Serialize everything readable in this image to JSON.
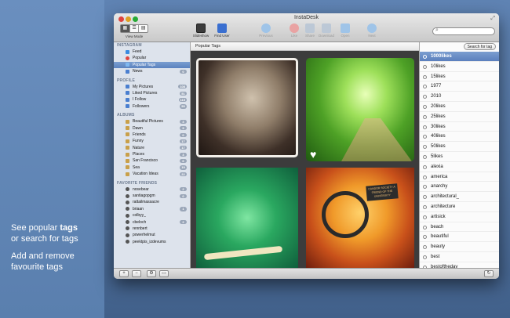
{
  "window": {
    "title": "InstaDesk"
  },
  "promo": {
    "line1_pre": "See popular ",
    "line1_bold": "tags",
    "line2": "or search for tags",
    "line3": "Add and remove favourite tags"
  },
  "toolbar": {
    "view_mode_label": "View Mode",
    "buttons": [
      {
        "label": "Slideshow",
        "icon": "slideshow-icon",
        "enabled": true
      },
      {
        "label": "Find User",
        "icon": "find-user-icon",
        "enabled": true
      },
      {
        "label": "Previous",
        "icon": "previous-arrow-icon",
        "enabled": false
      },
      {
        "label": "Like",
        "icon": "heart-icon",
        "enabled": false
      },
      {
        "label": "Share",
        "icon": "share-icon",
        "enabled": false
      },
      {
        "label": "Download",
        "icon": "download-icon",
        "enabled": false
      },
      {
        "label": "Open",
        "icon": "open-icon",
        "enabled": false
      },
      {
        "label": "Next",
        "icon": "next-arrow-icon",
        "enabled": false
      }
    ]
  },
  "sidebar": {
    "instagram": {
      "heading": "INSTAGRAM",
      "items": [
        {
          "label": "Feed",
          "badge": ""
        },
        {
          "label": "Popular",
          "badge": ""
        },
        {
          "label": "Popular Tags",
          "badge": ""
        },
        {
          "label": "News",
          "badge": "0"
        }
      ]
    },
    "profile": {
      "heading": "PROFILE",
      "items": [
        {
          "label": "My Pictures",
          "badge": "108"
        },
        {
          "label": "Liked Pictures",
          "badge": "51"
        },
        {
          "label": "I Follow",
          "badge": "115"
        },
        {
          "label": "Followers",
          "badge": "59"
        }
      ]
    },
    "albums": {
      "heading": "ALBUMS",
      "items": [
        {
          "label": "Beautiful Pictures",
          "badge": "3"
        },
        {
          "label": "Dawn",
          "badge": "9"
        },
        {
          "label": "Friends",
          "badge": "0"
        },
        {
          "label": "Funny",
          "badge": "17"
        },
        {
          "label": "Nature",
          "badge": "17"
        },
        {
          "label": "Places",
          "badge": "3"
        },
        {
          "label": "San Francisco",
          "badge": "6"
        },
        {
          "label": "Sea",
          "badge": "19"
        },
        {
          "label": "Vacation Ideas",
          "badge": "22"
        }
      ]
    },
    "friends": {
      "heading": "FAVORITE FRIENDS",
      "items": [
        {
          "label": "nosebear",
          "badge": "2"
        },
        {
          "label": "santiagopgm",
          "badge": "0"
        },
        {
          "label": "rattailmassacre",
          "badge": ""
        },
        {
          "label": "briaan",
          "badge": "1"
        },
        {
          "label": "colbyy_",
          "badge": ""
        },
        {
          "label": "cbeloch",
          "badge": "2"
        },
        {
          "label": "rennbert",
          "badge": ""
        },
        {
          "label": "powerhelmut",
          "badge": ""
        },
        {
          "label": "peektpis_izdevums",
          "badge": ""
        }
      ]
    }
  },
  "content": {
    "header": "Popular Tags"
  },
  "tags": {
    "search_button": "Search for tag",
    "items": [
      "1000likes",
      "10likes",
      "15likes",
      "1977",
      "2010",
      "20likes",
      "25likes",
      "30likes",
      "40likes",
      "50likes",
      "5likes",
      "alexia",
      "america",
      "anarchy",
      "architectural_",
      "architecture",
      "artisick",
      "beach",
      "beautiful",
      "beauty",
      "best",
      "bestoftheday"
    ]
  },
  "photo4_label": "CANDOR SOCIETY A FRIEND OF THE UNIVERSITY",
  "bottombar": {
    "add": "+",
    "remove": "−",
    "settings": "⚙",
    "refresh": "↻"
  },
  "colors": {
    "accent": "#5b82bf",
    "background": "#4a6d9c"
  }
}
